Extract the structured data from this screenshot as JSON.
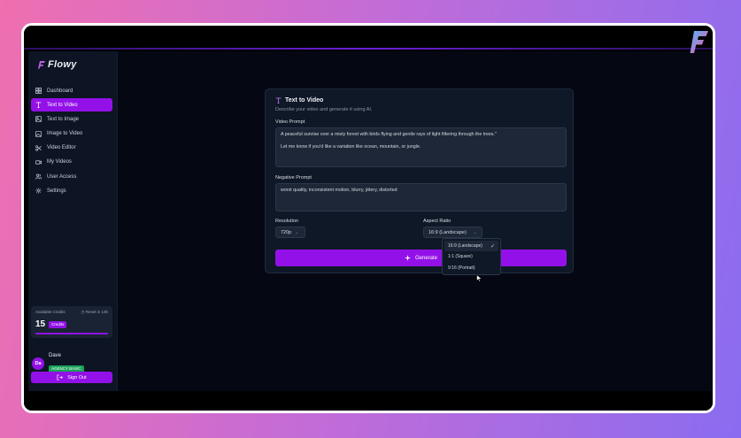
{
  "brand": {
    "name": "Flowy"
  },
  "sidebar": {
    "items": [
      {
        "label": "Dashboard",
        "icon": "dashboard-icon",
        "active": false
      },
      {
        "label": "Text to Video",
        "icon": "text-icon",
        "active": true
      },
      {
        "label": "Text to Image",
        "icon": "image-icon",
        "active": false
      },
      {
        "label": "Image to Video",
        "icon": "image-video-icon",
        "active": false
      },
      {
        "label": "Video Editor",
        "icon": "scissors-icon",
        "active": false
      },
      {
        "label": "My Videos",
        "icon": "video-camera-icon",
        "active": false
      },
      {
        "label": "User Access",
        "icon": "users-icon",
        "active": false
      },
      {
        "label": "Settings",
        "icon": "gear-icon",
        "active": false
      }
    ]
  },
  "credits": {
    "label": "Available Credits",
    "reset": "Reset in 13h",
    "count": "15",
    "badge": "Credits",
    "progress": 1.0
  },
  "user": {
    "initials": "Da",
    "name": "Dave",
    "plan": "AGENCY BASIC"
  },
  "signout": {
    "label": "Sign Out"
  },
  "card": {
    "title": "Text to Video",
    "subtitle": "Describe your video and generate it using AI.",
    "video_prompt": {
      "label": "Video Prompt",
      "value": "A peaceful sunrise over a misty forest with birds flying and gentle rays of light filtering through the trees.\"\n\nLet me know if you'd like a variation like ocean, mountain, or jungle."
    },
    "negative_prompt": {
      "label": "Negative Prompt",
      "value": "worst quality, inconsistent motion, blurry, jittery, distorted"
    },
    "resolution": {
      "label": "Resolution",
      "value": "720p"
    },
    "aspect_ratio": {
      "label": "Aspect Ratio",
      "value": "16:9 (Landscape)",
      "options": [
        "16:9 (Landscape)",
        "1:1 (Square)",
        "9:16 (Portrait)"
      ]
    },
    "generate_label": "Generate"
  },
  "colors": {
    "accent": "#9311e8",
    "panel": "#0f1826",
    "sidebar": "#0d1524",
    "success": "#1aa35a"
  }
}
